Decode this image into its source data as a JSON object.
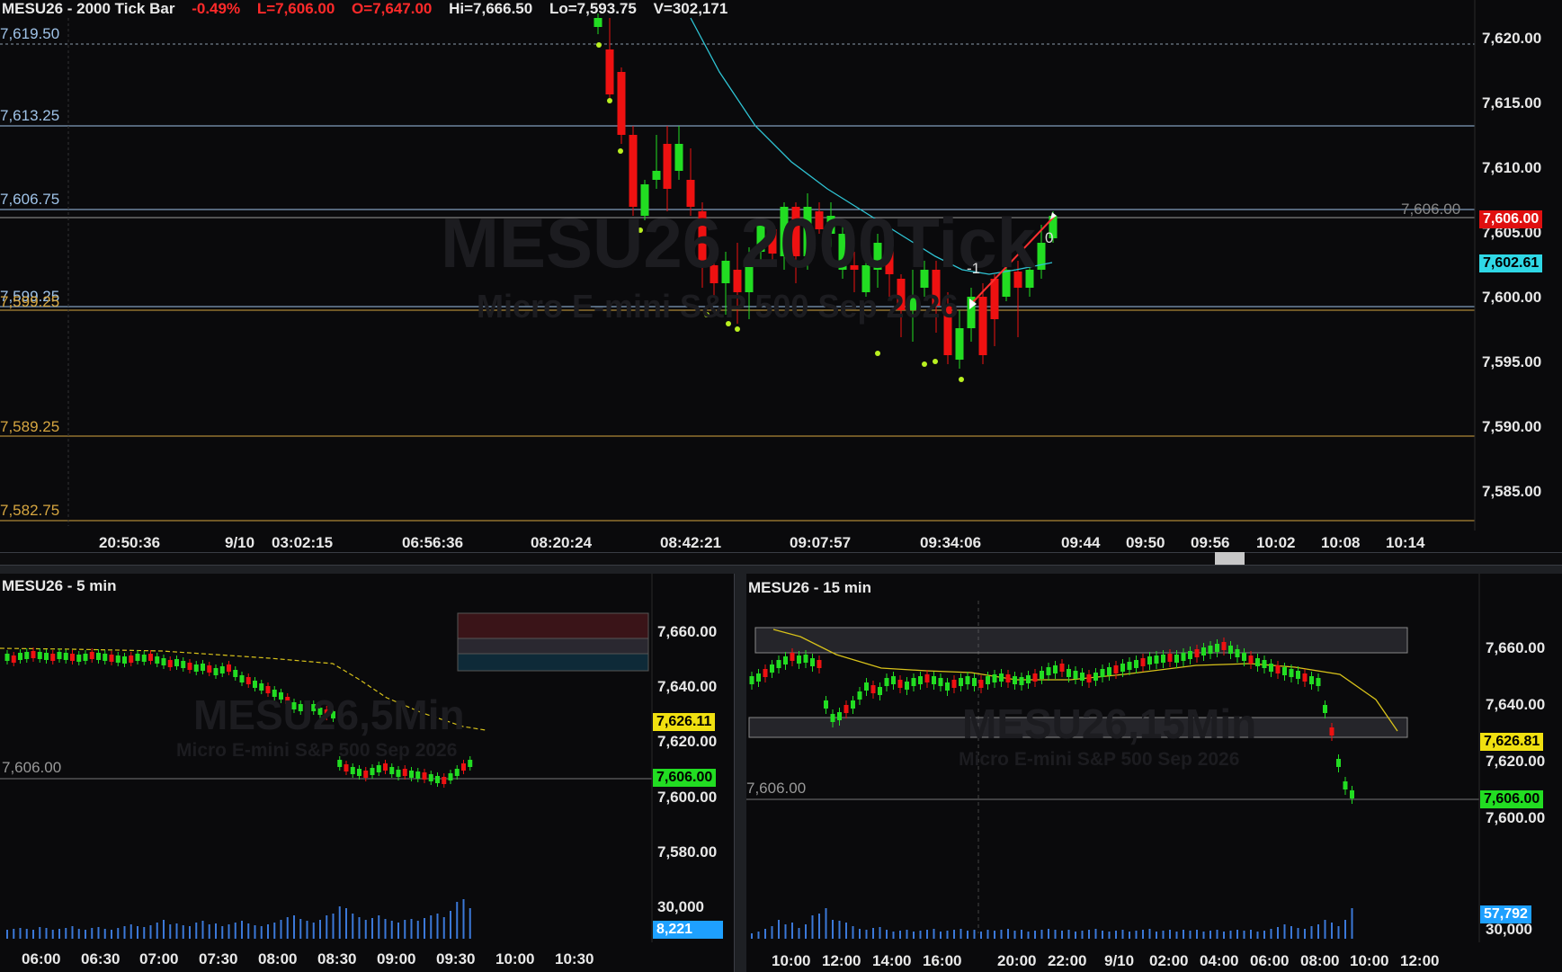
{
  "top": {
    "header": {
      "title": "MESU26 - 2000 Tick Bar",
      "chg": "-0.49%",
      "last": "L=7,606.00",
      "open": "O=7,647.00",
      "hi": "Hi=7,666.50",
      "lo": "Lo=7,593.75",
      "vol": "V=302,171"
    },
    "watermark": "MESU26 2000Tick",
    "watermark_sub": "Micro E-mini S&P 500 Sep 2026",
    "levels": [
      "7,619.50",
      "7,613.25",
      "7,606.75",
      "7,599.25",
      "7,589.25",
      "7,582.75"
    ],
    "price_ticks": [
      "7,620.00",
      "7,615.00",
      "7,610.00",
      "7,605.00",
      "7,600.00",
      "7,595.00",
      "7,590.00",
      "7,585.00"
    ],
    "badge_last": "7,606.00",
    "badge_ma": "7,602.61",
    "last_label": "7,606.00",
    "trade_labels": [
      "-1",
      "0"
    ],
    "time_ticks": [
      "20:50:36",
      "9/10",
      "03:02:15",
      "06:56:36",
      "08:20:24",
      "08:42:21",
      "09:07:57",
      "09:34:06",
      "09:44",
      "09:50",
      "09:56",
      "10:02",
      "10:08",
      "10:14"
    ]
  },
  "left": {
    "title": "MESU26 - 5 min",
    "watermark": "MESU26,5Min",
    "watermark_sub": "Micro E-mini S&P 500 Sep 2026",
    "last_label": "7,606.00",
    "price_ticks": [
      "7,660.00",
      "7,640.00",
      "7,620.00",
      "7,600.00",
      "7,580.00"
    ],
    "vol_tick": "30,000",
    "badge_ma": "7,626.11",
    "badge_last": "7,606.00",
    "badge_vol": "8,221",
    "time_ticks": [
      "06:00",
      "06:30",
      "07:00",
      "07:30",
      "08:00",
      "08:30",
      "09:00",
      "09:30",
      "10:00",
      "10:30"
    ]
  },
  "right": {
    "title": "MESU26 - 15 min",
    "watermark": "MESU26,15Min",
    "watermark_sub": "Micro E-mini S&P 500 Sep 2026",
    "last_label": "7,606.00",
    "price_ticks": [
      "7,660.00",
      "7,640.00",
      "7,620.00",
      "7,600.00"
    ],
    "vol_tick": "30,000",
    "badge_ma": "7,626.81",
    "badge_last": "7,606.00",
    "badge_vol": "57,792",
    "time_ticks": [
      "10:00",
      "12:00",
      "14:00",
      "16:00",
      "20:00",
      "22:00",
      "9/10",
      "02:00",
      "04:00",
      "06:00",
      "08:00",
      "10:00",
      "12:00"
    ]
  },
  "colors": {
    "up": "#22dd22",
    "down": "#ee1111",
    "ma": "#2fc4d4",
    "yellow": "#d8c21a",
    "level_blue": "#9fc3e8",
    "level_gold": "#d6a640"
  }
}
